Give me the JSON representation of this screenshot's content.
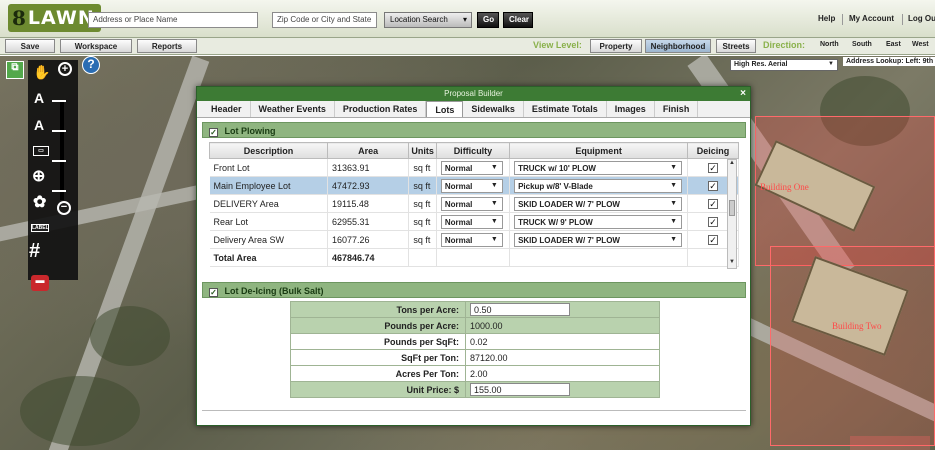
{
  "header": {
    "logo_prefix": "8",
    "logo_text": "LAWN",
    "address_placeholder": "Address or Place Name",
    "zip_placeholder": "Zip Code or City and State",
    "location_search": "Location Search",
    "go": "Go",
    "clear": "Clear",
    "links": [
      "Help",
      "My Account",
      "Log Out"
    ]
  },
  "toolbar": {
    "save": "Save",
    "workspace": "Workspace",
    "reports": "Reports",
    "view_level_label": "View Level:",
    "view_levels": [
      "Property",
      "Neighborhood",
      "Streets"
    ],
    "direction_label": "Direction:",
    "directions": [
      "North",
      "South",
      "East",
      "West"
    ]
  },
  "map": {
    "layer": "High Res. Aerial",
    "address_lookup": "Address Lookup: Left: 9th",
    "labels": [
      "Building One",
      "Building Two"
    ],
    "tools": {
      "label_tool": "LABEL"
    }
  },
  "dialog": {
    "title": "Proposal Builder",
    "close": "×",
    "tabs": [
      "Header",
      "Weather Events",
      "Production Rates",
      "Lots",
      "Sidewalks",
      "Estimate Totals",
      "Images",
      "Finish"
    ],
    "active_tab": "Lots",
    "lot_plowing": {
      "heading": "Lot Plowing",
      "columns": [
        "Description",
        "Area",
        "Units",
        "Difficulty",
        "Equipment",
        "Deicing"
      ],
      "rows": [
        {
          "description": "Front Lot",
          "area": "31363.91",
          "units": "sq ft",
          "difficulty": "Normal",
          "equipment": "TRUCK w/ 10' PLOW",
          "deicing": "✓"
        },
        {
          "description": "Main Employee Lot",
          "area": "47472.93",
          "units": "sq ft",
          "difficulty": "Normal",
          "equipment": "Pickup w/8' V-Blade",
          "deicing": "✓"
        },
        {
          "description": "DELIVERY Area",
          "area": "19115.48",
          "units": "sq ft",
          "difficulty": "Normal",
          "equipment": "SKID LOADER W/ 7' PLOW",
          "deicing": "✓"
        },
        {
          "description": "Rear Lot",
          "area": "62955.31",
          "units": "sq ft",
          "difficulty": "Normal",
          "equipment": "TRUCK W/ 9' PLOW",
          "deicing": "✓"
        },
        {
          "description": "Delivery Area SW",
          "area": "16077.26",
          "units": "sq ft",
          "difficulty": "Normal",
          "equipment": "SKID LOADER W/ 7' PLOW",
          "deicing": "✓"
        }
      ],
      "total_label": "Total Area",
      "total_value": "467846.74"
    },
    "lot_deicing": {
      "heading": "Lot De-Icing (Bulk Salt)",
      "fields": [
        {
          "label": "Tons per Acre:",
          "value": "0.50",
          "editable": true
        },
        {
          "label": "Pounds per Acre:",
          "value": "1000.00",
          "editable": false
        },
        {
          "label": "Pounds per SqFt:",
          "value": "0.02",
          "editable": false
        },
        {
          "label": "SqFt per Ton:",
          "value": "87120.00",
          "editable": false
        },
        {
          "label": "Acres Per Ton:",
          "value": "2.00",
          "editable": false
        },
        {
          "label": "Unit Price: $",
          "value": "155.00",
          "editable": true
        }
      ]
    }
  },
  "colors": {
    "brand_green": "#6d8a30",
    "dialog_title": "#3d7b34",
    "section_header": "#8fb580",
    "selected_row": "#b5cfe6",
    "parcel_red": "#ff6a6a"
  }
}
